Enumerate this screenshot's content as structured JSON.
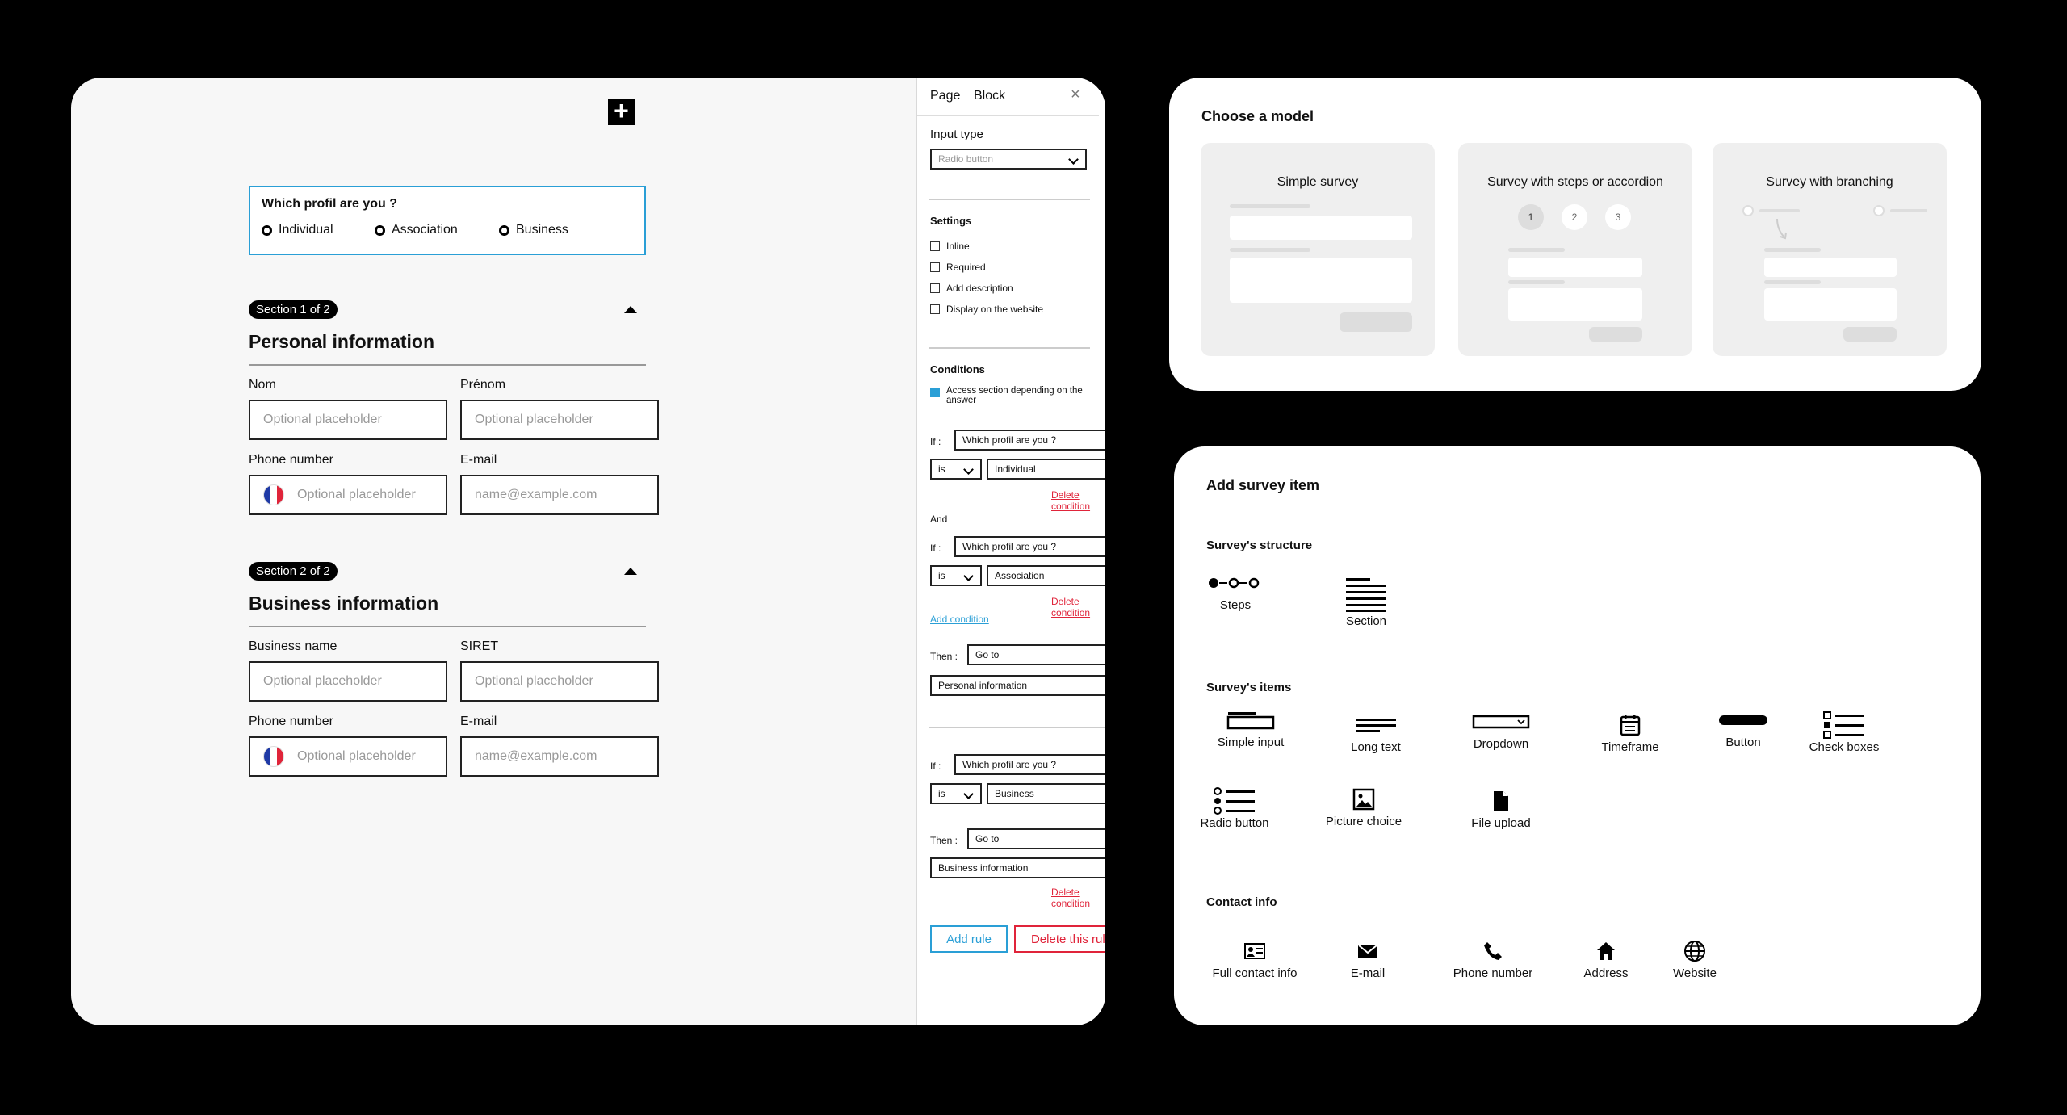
{
  "editor": {
    "add_icon": "plus-icon",
    "question": {
      "title": "Which profil are you ?",
      "options": [
        "Individual",
        "Association",
        "Business"
      ]
    },
    "sections": [
      {
        "badge": "Section 1 of 2",
        "title": "Personal information",
        "fields": [
          {
            "label": "Nom",
            "placeholder": "Optional placeholder"
          },
          {
            "label": "Prénom",
            "placeholder": "Optional placeholder"
          },
          {
            "label": "Phone number",
            "placeholder": "Optional placeholder"
          },
          {
            "label": "E-mail",
            "placeholder": "name@example.com"
          }
        ]
      },
      {
        "badge": "Section 2 of 2",
        "title": "Business information",
        "fields": [
          {
            "label": "Business name",
            "placeholder": "Optional placeholder"
          },
          {
            "label": "SIRET",
            "placeholder": "Optional placeholder"
          },
          {
            "label": "Phone number",
            "placeholder": "Optional placeholder"
          },
          {
            "label": "E-mail",
            "placeholder": "name@example.com"
          }
        ]
      }
    ]
  },
  "props": {
    "tabs": [
      "Page",
      "Block"
    ],
    "input_type_label": "Input type",
    "input_type_value": "Radio button",
    "settings_label": "Settings",
    "settings": [
      "Inline",
      "Required",
      "Add description",
      "Display on the website"
    ],
    "conditions_label": "Conditions",
    "conditions_checkbox": "Access section depending on the answer",
    "if_label": "If :",
    "and_label": "And",
    "then_label": "Then :",
    "rule1": {
      "cond1": {
        "question": "Which profil are you ?",
        "op": "is",
        "value": "Individual"
      },
      "cond2": {
        "question": "Which profil are you ?",
        "op": "is",
        "value": "Association"
      },
      "action": "Go to",
      "target": "Personal information"
    },
    "rule2": {
      "cond1": {
        "question": "Which profil are you ?",
        "op": "is",
        "value": "Business"
      },
      "action": "Go to",
      "target": "Business information"
    },
    "delete_condition": "Delete condition",
    "add_condition": "Add condition",
    "add_rule": "Add rule",
    "delete_rule": "Delete this rule"
  },
  "models": {
    "title": "Choose a model",
    "cards": [
      "Simple survey",
      "Survey with steps or accordion",
      "Survey with branching"
    ],
    "steps": [
      "1",
      "2",
      "3"
    ]
  },
  "items": {
    "title": "Add survey item",
    "structure_label": "Survey's structure",
    "structure": [
      {
        "label": "Steps",
        "icon": "steps-icon"
      },
      {
        "label": "Section",
        "icon": "section-icon"
      }
    ],
    "items_label": "Survey's items",
    "survey_items": [
      {
        "label": "Simple input",
        "icon": "simple-input-icon"
      },
      {
        "label": "Long text",
        "icon": "long-text-icon"
      },
      {
        "label": "Dropdown",
        "icon": "dropdown-icon"
      },
      {
        "label": "Timeframe",
        "icon": "calendar-icon"
      },
      {
        "label": "Button",
        "icon": "button-icon"
      },
      {
        "label": "Check boxes",
        "icon": "checkboxes-icon"
      },
      {
        "label": "Radio button",
        "icon": "radio-list-icon"
      },
      {
        "label": "Picture choice",
        "icon": "picture-icon"
      },
      {
        "label": "File upload",
        "icon": "file-icon"
      }
    ],
    "contact_label": "Contact info",
    "contact": [
      {
        "label": "Full contact info",
        "icon": "contact-card-icon"
      },
      {
        "label": "E-mail",
        "icon": "mail-icon"
      },
      {
        "label": "Phone number",
        "icon": "phone-icon"
      },
      {
        "label": "Address",
        "icon": "home-icon"
      },
      {
        "label": "Website",
        "icon": "globe-icon"
      }
    ]
  },
  "colors": {
    "accent": "#2a9fd6",
    "danger": "#e0243a"
  }
}
